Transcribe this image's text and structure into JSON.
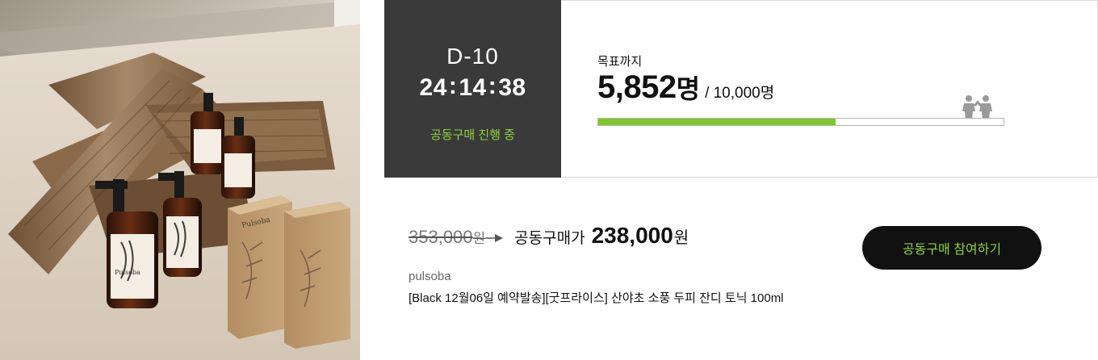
{
  "photo": {
    "alt": "Pulsoba product photo",
    "box_brand_text": "Pulsoba",
    "bottle_brand_text": "Pulsoba"
  },
  "countdown": {
    "dday": "D-10",
    "hours": "24",
    "minutes": "14",
    "seconds": "38",
    "separator": ":",
    "status": "공동구매 진행 중"
  },
  "progress": {
    "goal_label": "목표까지",
    "current_count": "5,852",
    "current_unit": "명",
    "total": "/ 10,000명",
    "fraction": 0.5852,
    "people_icon": "people-icon"
  },
  "price": {
    "original": "353,000",
    "original_unit": "원",
    "arrow_icon": "arrow-right-icon",
    "group_label": "공동구매가",
    "group_price": "238,000",
    "group_unit": "원"
  },
  "product": {
    "brand": "pulsoba",
    "name": "[Black 12월06일 예약발송][굿프라이스] 산야초 소풍 두피 잔디 토닉 100ml"
  },
  "action": {
    "join_label": "공동구매 참여하기"
  },
  "colors": {
    "accent_green": "#8bd43a",
    "bar_green": "#7dc728",
    "dark_panel": "#3a3a3a",
    "button_bg": "#111111"
  }
}
